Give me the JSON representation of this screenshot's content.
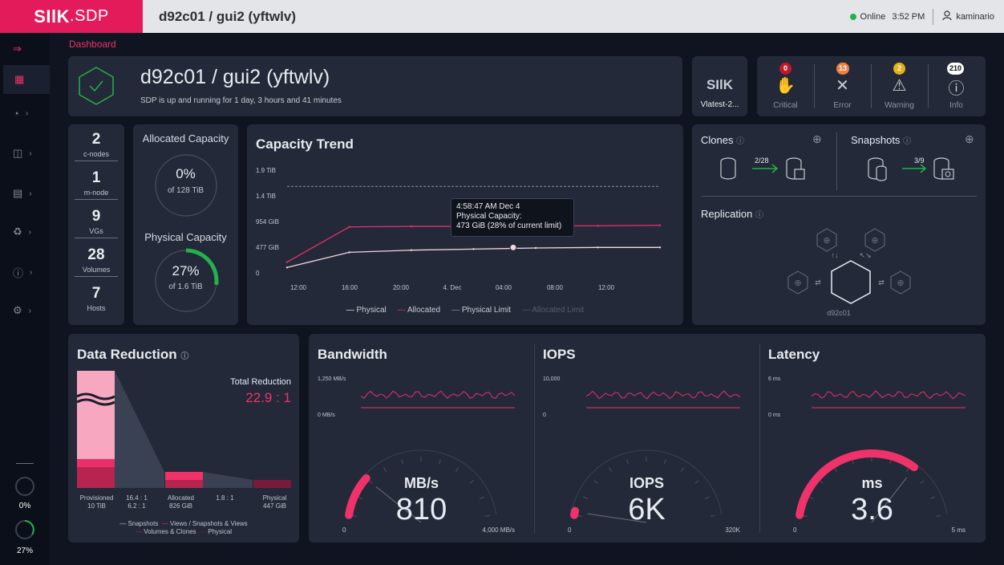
{
  "app": {
    "logo_main": "SIlK",
    "logo_sub": ".SDP",
    "window_title": "d92c01 / gui2 (yftwlv)"
  },
  "topbar": {
    "status": "Online",
    "time": "3:52 PM",
    "user": "kaminario"
  },
  "breadcrumb": "Dashboard",
  "sidebar": {
    "bottom_pct_1": "0%",
    "bottom_pct_2": "27%"
  },
  "system": {
    "title": "d92c01 / gui2 (yftwlv)",
    "subtitle": "SDP is up and running for 1 day, 3 hours and 41 minutes"
  },
  "version": {
    "logo": "SIlK",
    "label": "Vlatest-2..."
  },
  "alerts": [
    {
      "label": "Critical",
      "count": "0",
      "color": "#c0182b"
    },
    {
      "label": "Error",
      "count": "13",
      "color": "#f08040"
    },
    {
      "label": "Warning",
      "count": "2",
      "color": "#e5b21a"
    },
    {
      "label": "Info",
      "count": "210",
      "color": "#ffffff"
    }
  ],
  "stats": [
    {
      "value": "2",
      "label": "c-nodes"
    },
    {
      "value": "1",
      "label": "m-node"
    },
    {
      "value": "9",
      "label": "VGs"
    },
    {
      "value": "28",
      "label": "Volumes"
    },
    {
      "value": "7",
      "label": "Hosts"
    }
  ],
  "allocated": {
    "title": "Allocated Capacity",
    "pct": "0%",
    "of": "of 128 TiB",
    "fraction": 0.0
  },
  "physical": {
    "title": "Physical Capacity",
    "pct": "27%",
    "of": "of 1.6 TiB",
    "fraction": 0.27
  },
  "capacity_trend": {
    "title": "Capacity Trend",
    "tooltip": {
      "time": "4:58:47 AM Dec 4",
      "line1": "Physical Capacity:",
      "line2": "473 GiB (28% of current limit)"
    },
    "legend": [
      "Physical",
      "Allocated",
      "Physical Limit",
      "Allocated Limit"
    ]
  },
  "chart_data": {
    "type": "line",
    "title": "Capacity Trend",
    "x": [
      "12:00",
      "16:00",
      "20:00",
      "4. Dec",
      "04:00",
      "08:00",
      "12:00"
    ],
    "y_ticks": [
      "1.9 TiB",
      "1.4 TiB",
      "954 GiB",
      "477 GiB",
      "0"
    ],
    "series": [
      {
        "name": "Physical Limit",
        "values": [
          1.6,
          1.6,
          1.6,
          1.6,
          1.6,
          1.6,
          1.6
        ]
      },
      {
        "name": "Allocated",
        "values": [
          0.2,
          0.85,
          0.86,
          0.86,
          0.87,
          0.87,
          0.88
        ]
      },
      {
        "name": "Physical",
        "values": [
          0.1,
          0.38,
          0.42,
          0.44,
          0.46,
          0.47,
          0.47
        ]
      }
    ]
  },
  "clones": {
    "title": "Clones",
    "ratio": "2/28"
  },
  "snapshots": {
    "title": "Snapshots",
    "ratio": "3/9"
  },
  "replication": {
    "title": "Replication",
    "node": "d92c01"
  },
  "data_reduction": {
    "title": "Data Reduction",
    "total_label": "Total Reduction",
    "total_value": "22.9 : 1",
    "columns": [
      {
        "label": "Provisioned",
        "value": "10 TiB"
      },
      {
        "label": "16.4 : 1",
        "value": "6.2 : 1"
      },
      {
        "label": "Allocated",
        "value": "826 GiB"
      },
      {
        "label": "",
        "value": "1.8 : 1"
      },
      {
        "label": "Physical",
        "value": "447 GiB"
      }
    ],
    "legend": [
      "Snapshots",
      "Views / Snapshots & Views",
      "Volumes & Clones",
      "Physical"
    ]
  },
  "bandwidth": {
    "title": "Bandwidth",
    "y_top": "1,250 MB/s",
    "y_bottom": "0 MB/s",
    "unit": "MB/s",
    "value": "810",
    "min": "0",
    "max": "4,000 MB/s",
    "fraction": 0.2
  },
  "iops": {
    "title": "IOPS",
    "y_top": "10,000",
    "y_bottom": "0",
    "unit": "IOPS",
    "value": "6K",
    "min": "0",
    "max": "320K",
    "fraction": 0.02
  },
  "latency": {
    "title": "Latency",
    "y_top": "6 ms",
    "y_bottom": "0 ms",
    "unit": "ms",
    "value": "3.6",
    "min": "0",
    "max": "5 ms",
    "fraction": 0.72
  },
  "colors": {
    "accent": "#f0326b",
    "panel": "#232938",
    "bg": "#0f1420",
    "green": "#22b14c"
  }
}
